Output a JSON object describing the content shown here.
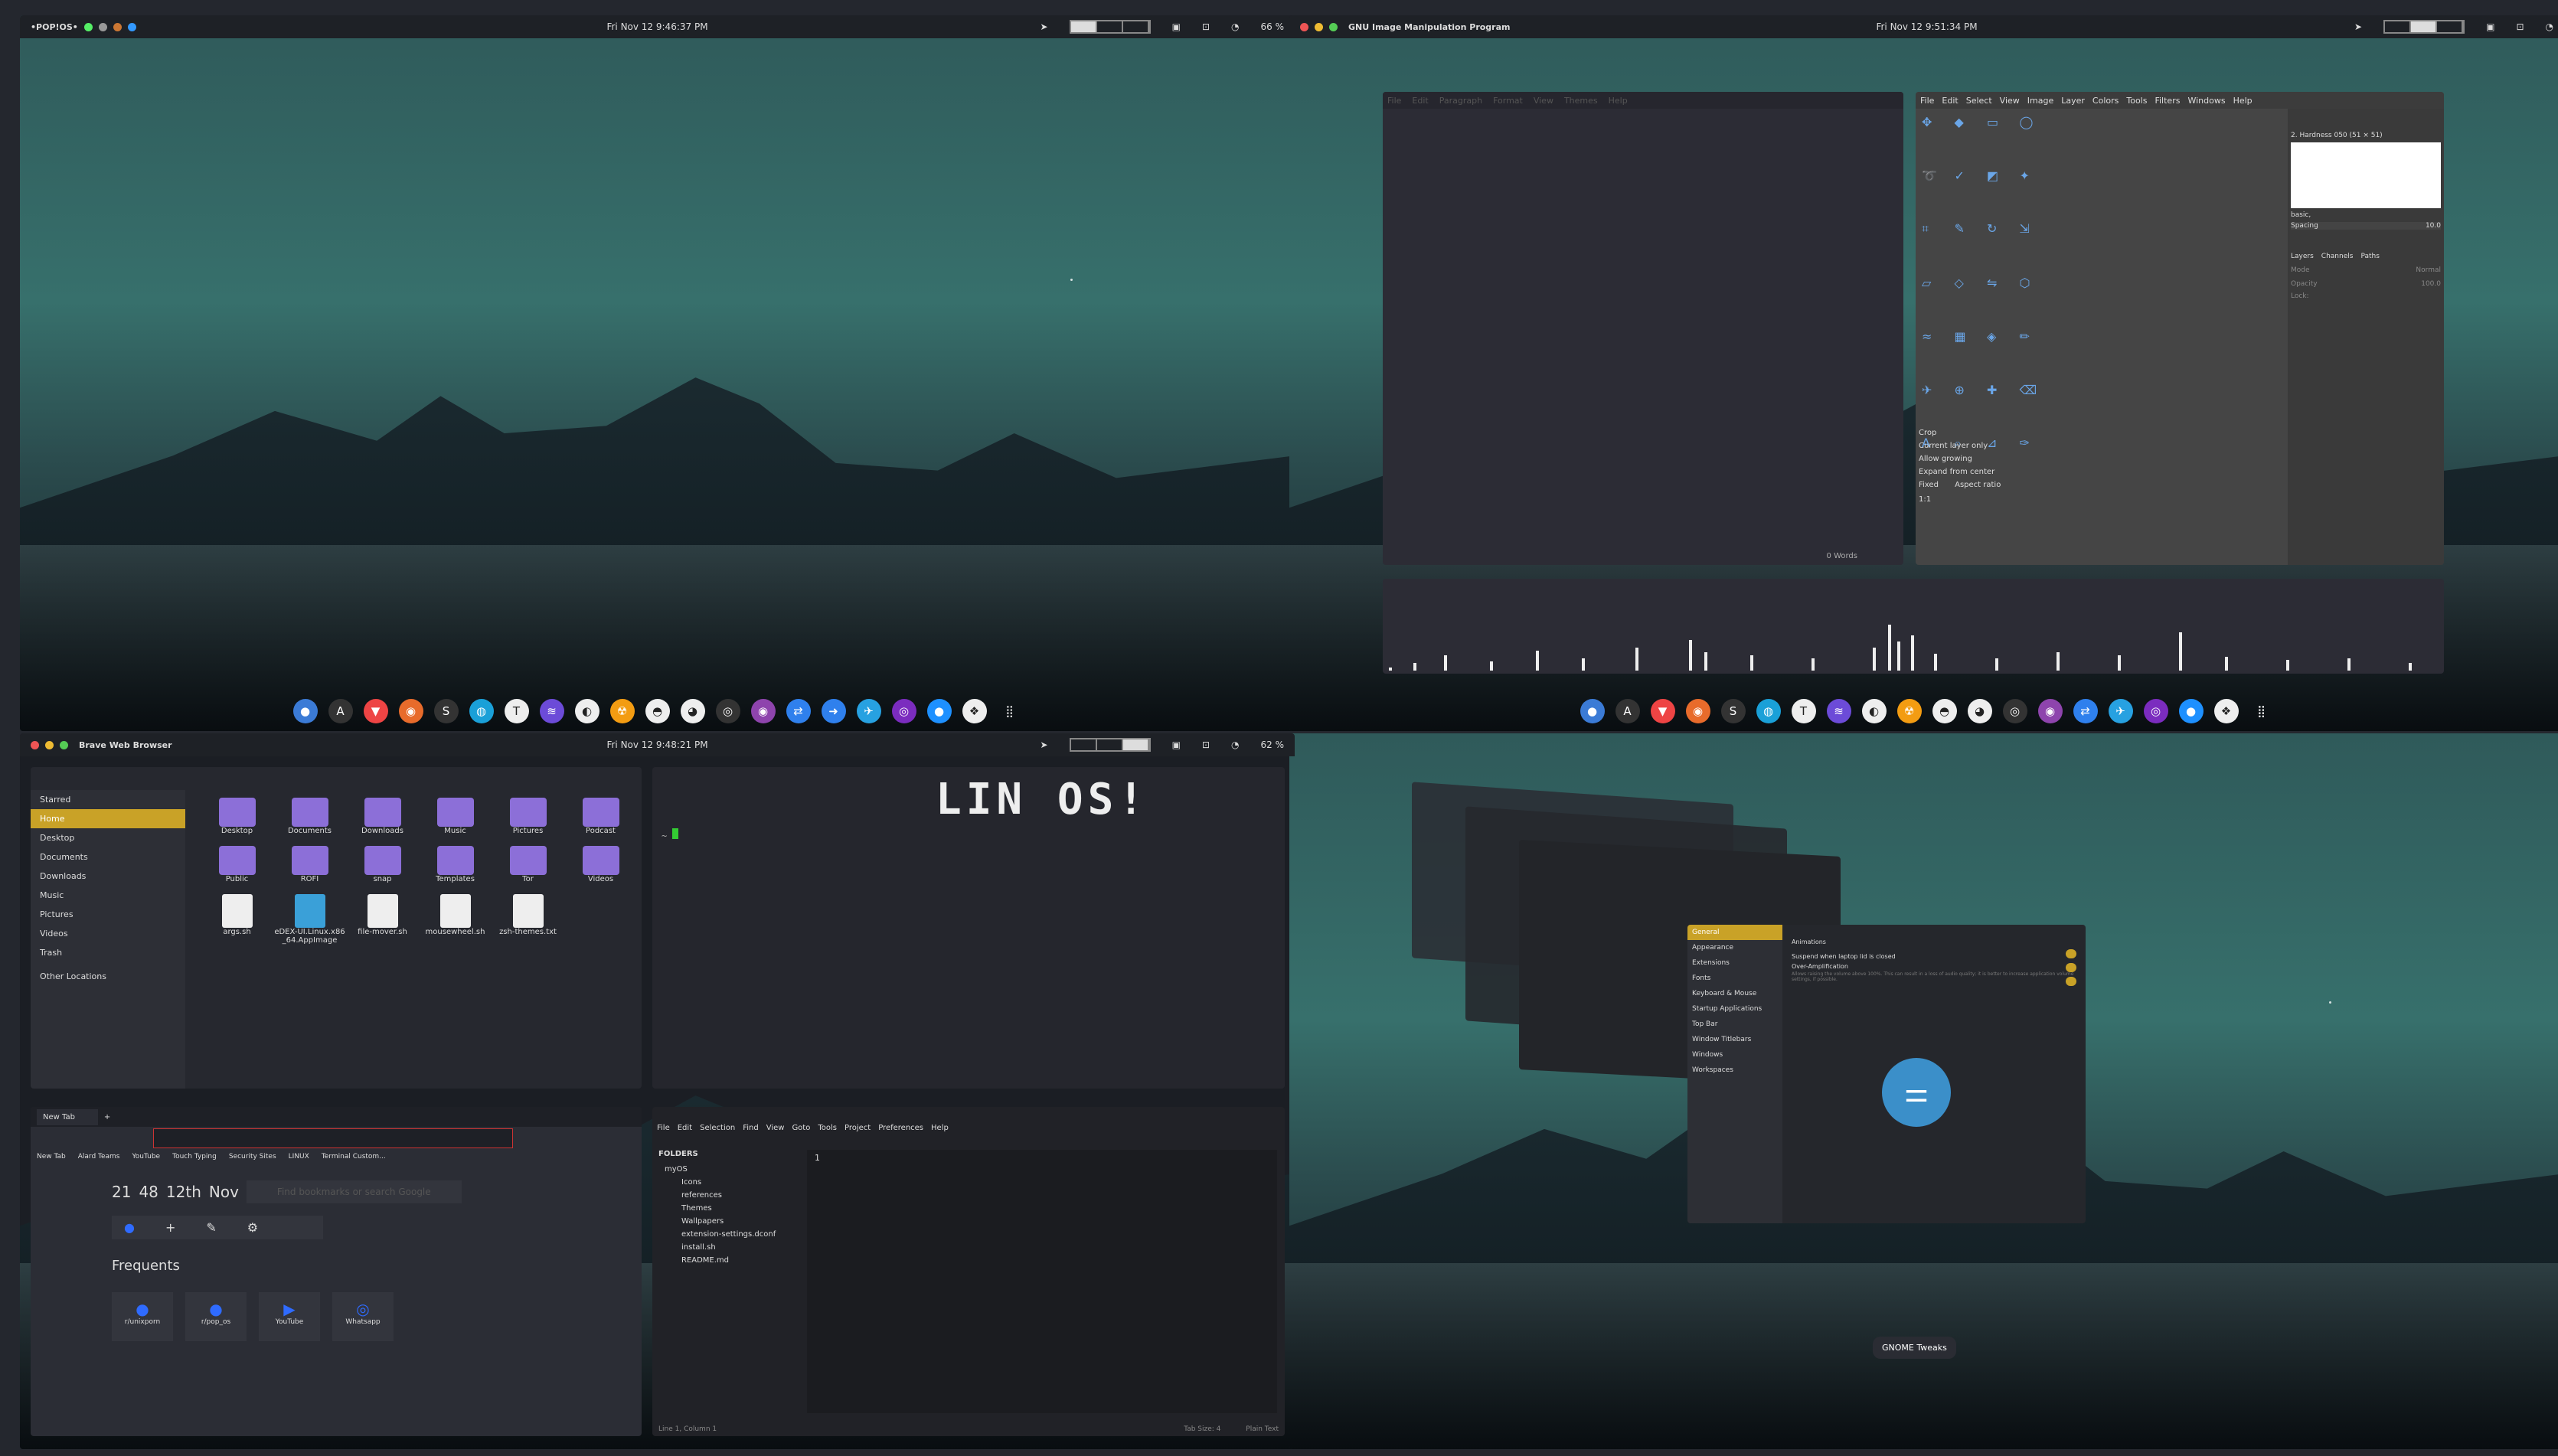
{
  "q1": {
    "top_left": "•POP!OS•",
    "clock": "Fri Nov 12  9:46:37 PM",
    "battery": "66 %"
  },
  "q2": {
    "top_left": "GNU Image Manipulation Program",
    "clock": "Fri Nov 12  9:51:34 PM",
    "editor_menu": [
      "File",
      "Edit",
      "Paragraph",
      "Format",
      "View",
      "Themes",
      "Help"
    ],
    "editor_status": "0 Words",
    "gimp_menu": [
      "File",
      "Edit",
      "Select",
      "View",
      "Image",
      "Layer",
      "Colors",
      "Tools",
      "Filters",
      "Windows",
      "Help"
    ],
    "brush_name": "2. Hardness 050 (51 × 51)",
    "brush_tag": "basic,",
    "spacing_label": "Spacing",
    "spacing_value": "10.0",
    "tabs": [
      "Layers",
      "Channels",
      "Paths"
    ],
    "mode_label": "Mode",
    "mode_value": "Normal",
    "opacity_label": "Opacity",
    "opacity_value": "100.0",
    "lock_label": "Lock:",
    "crop_title": "Crop",
    "crop_opts": [
      "Current layer only",
      "Allow growing",
      "Expand from center",
      "Fixed"
    ],
    "aspect": "Aspect ratio",
    "ratio": "1:1"
  },
  "q3": {
    "top_left": "Brave Web Browser",
    "clock": "Fri Nov 12  9:48:21 PM",
    "battery": "62 %",
    "sidebar": [
      "Starred",
      "Home",
      "Desktop",
      "Documents",
      "Downloads",
      "Music",
      "Pictures",
      "Videos",
      "Trash",
      "Other Locations"
    ],
    "files": [
      {
        "n": "Desktop",
        "t": "dir"
      },
      {
        "n": "Documents",
        "t": "dir"
      },
      {
        "n": "Downloads",
        "t": "dir"
      },
      {
        "n": "Music",
        "t": "dir"
      },
      {
        "n": "Pictures",
        "t": "dir"
      },
      {
        "n": "Podcast",
        "t": "dir"
      },
      {
        "n": "Public",
        "t": "dir"
      },
      {
        "n": "ROFI",
        "t": "dir"
      },
      {
        "n": "snap",
        "t": "dir"
      },
      {
        "n": "Templates",
        "t": "dir"
      },
      {
        "n": "Tor",
        "t": "dir"
      },
      {
        "n": "Videos",
        "t": "dir"
      },
      {
        "n": "args.sh",
        "t": "sh"
      },
      {
        "n": "eDEX-UI.Linux.x86_64.AppImage",
        "t": "app"
      },
      {
        "n": "file-mover.sh",
        "t": "sh"
      },
      {
        "n": "mousewheel.sh",
        "t": "sh"
      },
      {
        "n": "zsh-themes.txt",
        "t": "txt"
      }
    ],
    "ascii": "LIN OS!",
    "prompt": "~ ",
    "browser_tab": "New Tab",
    "bookmarks": [
      "New Tab",
      "Alard Teams",
      "YouTube",
      "Touch Typing",
      "Security Sites",
      "LINUX",
      "Terminal Custom..."
    ],
    "clock_h": "21",
    "clock_m": "48",
    "date": "12th",
    "month": "Nov",
    "search_ph": "Find bookmarks or search Google",
    "frequents": "Frequents",
    "sites": [
      "r/unixporn",
      "r/pop_os",
      "YouTube",
      "Whatsapp"
    ],
    "sub_menu": [
      "File",
      "Edit",
      "Selection",
      "Find",
      "View",
      "Goto",
      "Tools",
      "Project",
      "Preferences",
      "Help"
    ],
    "folders_label": "FOLDERS",
    "tree": [
      "myOS",
      "Icons",
      "references",
      "Themes",
      "Wallpapers",
      "extension-settings.dconf",
      "install.sh",
      "README.md"
    ],
    "line_no": "1",
    "status_left": "Line 1, Column 1",
    "tab_size": "Tab Size: 4",
    "syntax": "Plain Text"
  },
  "q4": {
    "tweaks_sidebar": [
      "General",
      "Appearance",
      "Extensions",
      "Fonts",
      "Keyboard & Mouse",
      "Startup Applications",
      "Top Bar",
      "Window Titlebars",
      "Windows",
      "Workspaces"
    ],
    "animations": "Animations",
    "suspend": "Suspend when laptop lid is closed",
    "overamp": "Over-Amplification",
    "overamp_desc": "Allows raising the volume above 100%. This can result in a loss of audio quality; it is better to increase application volume settings, if possible.",
    "label": "GNOME Tweaks"
  },
  "colors": {
    "accent": "#c9a227",
    "folder": "#8c6fd8",
    "panel": "#1e2126"
  }
}
